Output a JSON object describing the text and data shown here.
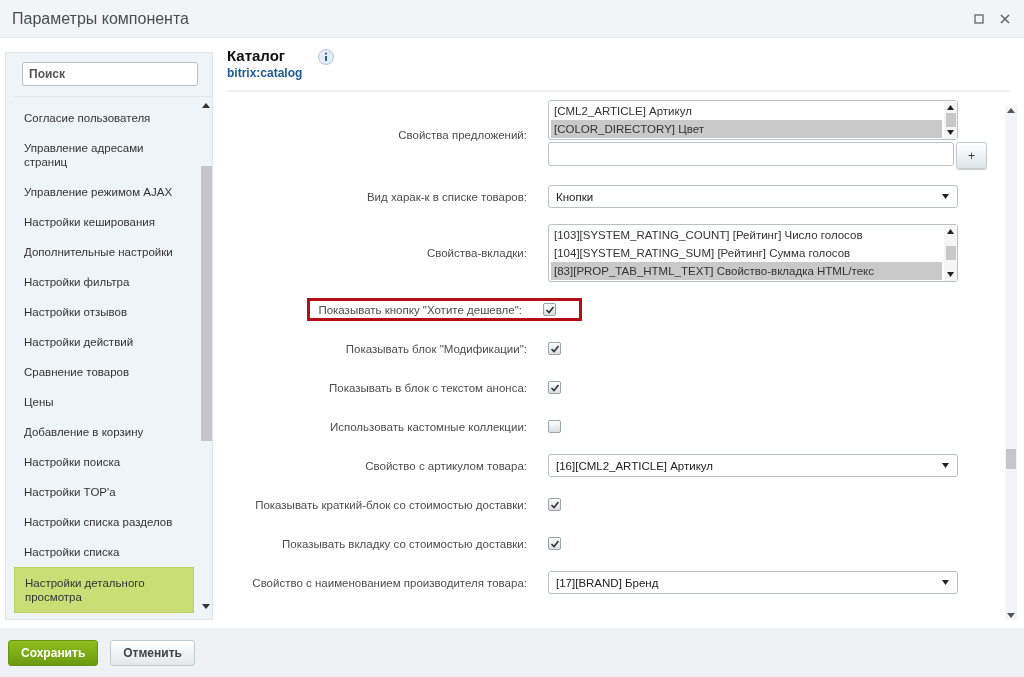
{
  "window": {
    "title": "Параметры компонента"
  },
  "sidebar": {
    "search": {
      "placeholder": "Поиск"
    },
    "items": [
      {
        "label": "Согласие пользователя",
        "selected": false
      },
      {
        "label": "Управление адресами страниц",
        "selected": false
      },
      {
        "label": "Управление режимом AJAX",
        "selected": false
      },
      {
        "label": "Настройки кеширования",
        "selected": false
      },
      {
        "label": "Дополнительные настройки",
        "selected": false
      },
      {
        "label": "Настройки фильтра",
        "selected": false
      },
      {
        "label": "Настройки отзывов",
        "selected": false
      },
      {
        "label": "Настройки действий",
        "selected": false
      },
      {
        "label": "Сравнение товаров",
        "selected": false
      },
      {
        "label": "Цены",
        "selected": false
      },
      {
        "label": "Добавление в корзину",
        "selected": false
      },
      {
        "label": "Настройки поиска",
        "selected": false
      },
      {
        "label": "Настройки TOP'а",
        "selected": false
      },
      {
        "label": "Настройки списка разделов",
        "selected": false
      },
      {
        "label": "Настройки списка",
        "selected": false
      },
      {
        "label": "Настройки детального просмотра",
        "selected": true
      }
    ]
  },
  "component": {
    "title": "Каталог",
    "code": "bitrix:catalog"
  },
  "fields": [
    {
      "kind": "multiselect",
      "label": "Свойства предложений:",
      "highlighted": false,
      "options": [
        {
          "text": "[CML2_ARTICLE] Артикул",
          "selected": false
        },
        {
          "text": "[COLOR_DIRECTORY] Цвет",
          "selected": true
        }
      ],
      "add_button": "+"
    },
    {
      "kind": "select",
      "label": "Вид харак-к в списке товаров:",
      "highlighted": false,
      "value": "Кнопки"
    },
    {
      "kind": "multiselect",
      "label": "Свойства-вкладки:",
      "highlighted": false,
      "options": [
        {
          "text": "[103][SYSTEM_RATING_COUNT] [Рейтинг] Число голосов",
          "selected": false
        },
        {
          "text": "[104][SYSTEM_RATING_SUM] [Рейтинг] Сумма голосов",
          "selected": false
        },
        {
          "text": "[83][PROP_TAB_HTML_TEXT] Свойство-вкладка HTML/текс",
          "selected": true
        }
      ]
    },
    {
      "kind": "checkbox",
      "label": "Показывать кнопку \"Хотите дешевле\":",
      "highlighted": true,
      "checked": true
    },
    {
      "kind": "checkbox",
      "label": "Показывать блок \"Модификации\":",
      "highlighted": false,
      "checked": true
    },
    {
      "kind": "checkbox",
      "label": "Показывать в блок с текстом анонса:",
      "highlighted": false,
      "checked": true
    },
    {
      "kind": "checkbox",
      "label": "Использовать кастомные коллекции:",
      "highlighted": false,
      "checked": false
    },
    {
      "kind": "select",
      "label": "Свойство с артикулом товара:",
      "highlighted": false,
      "value": "[16][CML2_ARTICLE] Артикул"
    },
    {
      "kind": "checkbox",
      "label": "Показывать краткий-блок со стоимостью доставки:",
      "highlighted": false,
      "checked": true
    },
    {
      "kind": "checkbox",
      "label": "Показывать вкладку со стоимостью доставки:",
      "highlighted": false,
      "checked": true
    },
    {
      "kind": "select",
      "label": "Свойство с наименованием производителя товара:",
      "highlighted": false,
      "value": "[17][BRAND] Бренд"
    }
  ],
  "footer": {
    "buttons": [
      {
        "kind": "primary",
        "label": "Сохранить"
      },
      {
        "kind": "secondary",
        "label": "Отменить"
      }
    ]
  }
}
